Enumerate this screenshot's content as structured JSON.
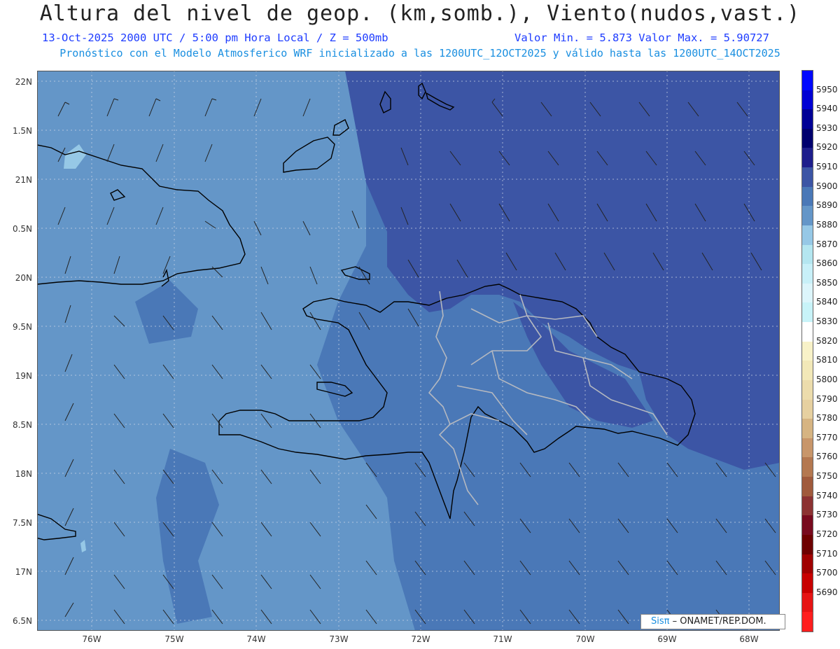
{
  "header": {
    "title": "Altura del nivel de geop. (km,somb.), Viento(nudos,vast.)",
    "date_info": "13-Oct-2025  2000 UTC / 5:00 pm Hora Local / Z = 500mb",
    "minmax": "Valor Min. = 5.873  Valor Max. = 5.90727",
    "model_info": "Pronóstico con el Modelo Atmosferico WRF inicializado a las 1200UTC_12OCT2025 y válido hasta las  1200UTC_14OCT2025"
  },
  "axes": {
    "lat_labels": [
      "22N",
      "1.5N",
      "21N",
      "0.5N",
      "20N",
      "9.5N",
      "19N",
      "8.5N",
      "18N",
      "7.5N",
      "17N",
      "6.5N"
    ],
    "lon_labels": [
      "76W",
      "75W",
      "74W",
      "73W",
      "72W",
      "71W",
      "70W",
      "69W",
      "68W"
    ]
  },
  "colorbar": {
    "labels": [
      "5950",
      "5940",
      "5930",
      "5920",
      "5910",
      "5900",
      "5890",
      "5880",
      "5870",
      "5860",
      "5850",
      "5840",
      "5830",
      "5820",
      "5810",
      "5800",
      "5790",
      "5780",
      "5770",
      "5760",
      "5750",
      "5740",
      "5730",
      "5720",
      "5710",
      "5700",
      "5690"
    ],
    "colors": [
      "#0008ff",
      "#0000d4",
      "#000096",
      "#00006e",
      "#1e1e8c",
      "#3c55a5",
      "#4a78b7",
      "#6496c8",
      "#96c8e6",
      "#b4e6f0",
      "#c8f0f8",
      "#dcf5fb",
      "#c8f3f8",
      "#ffffff",
      "#f8f2c8",
      "#f2e8b8",
      "#ecdcac",
      "#e6d0a0",
      "#d6b482",
      "#c8966a",
      "#b47850",
      "#a05a3c",
      "#8c3232",
      "#780a1e",
      "#6e0000",
      "#a00000",
      "#c80000",
      "#e61414",
      "#ff1e1e"
    ],
    "accent_colors": {
      "level_5880": "#6496c8",
      "level_5890": "#4a78b7",
      "level_5900": "#3c55a5"
    }
  },
  "credit": {
    "brand": "Sisπ",
    "text": "– ONAMET/REP.DOM."
  }
}
